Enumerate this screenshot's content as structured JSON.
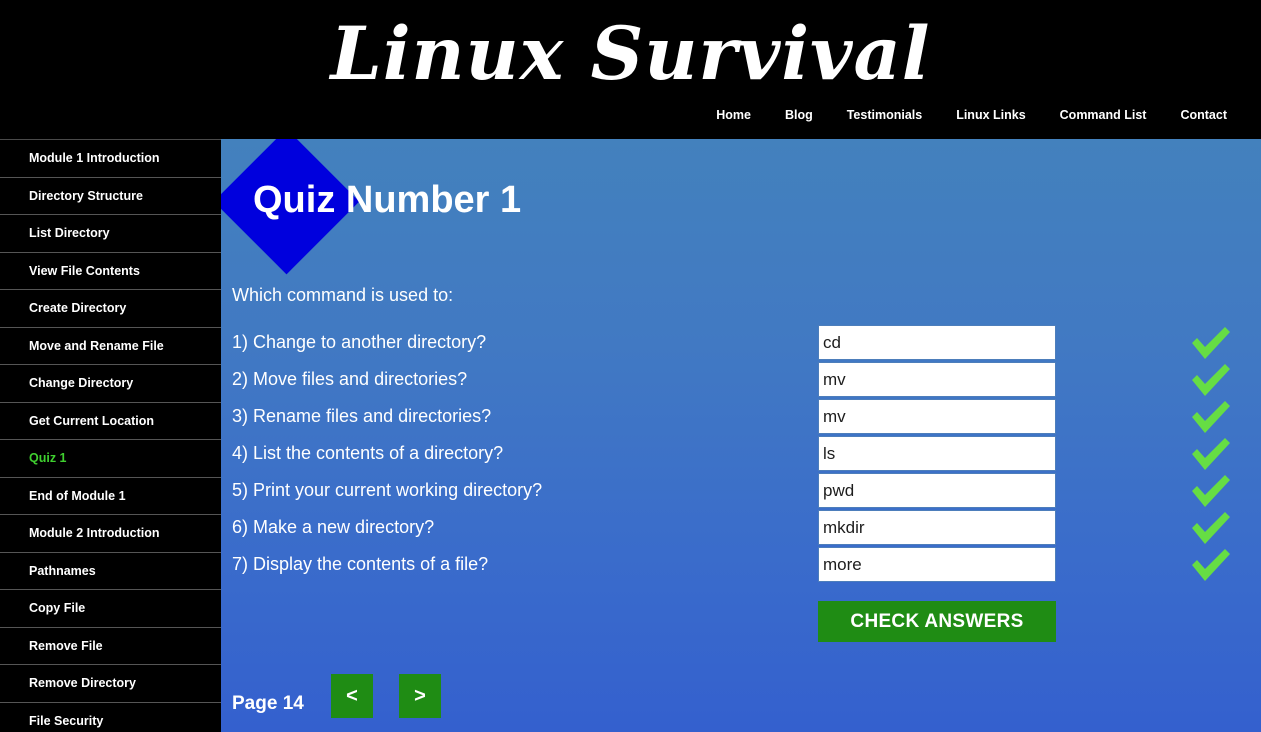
{
  "header": {
    "logo_text": "Linux Survival",
    "nav": [
      {
        "label": "Home"
      },
      {
        "label": "Blog"
      },
      {
        "label": "Testimonials"
      },
      {
        "label": "Linux Links"
      },
      {
        "label": "Command List"
      },
      {
        "label": "Contact"
      }
    ]
  },
  "sidebar": {
    "items": [
      {
        "label": "Module 1 Introduction",
        "active": false
      },
      {
        "label": "Directory Structure",
        "active": false
      },
      {
        "label": "List Directory",
        "active": false
      },
      {
        "label": "View File Contents",
        "active": false
      },
      {
        "label": "Create Directory",
        "active": false
      },
      {
        "label": "Move and Rename File",
        "active": false
      },
      {
        "label": "Change Directory",
        "active": false
      },
      {
        "label": "Get Current Location",
        "active": false
      },
      {
        "label": "Quiz 1",
        "active": true
      },
      {
        "label": "End of Module 1",
        "active": false
      },
      {
        "label": "Module 2 Introduction",
        "active": false
      },
      {
        "label": "Pathnames",
        "active": false
      },
      {
        "label": "Copy File",
        "active": false
      },
      {
        "label": "Remove File",
        "active": false
      },
      {
        "label": "Remove Directory",
        "active": false
      },
      {
        "label": "File Security",
        "active": false
      }
    ],
    "active_color": "#3fcf2f"
  },
  "main": {
    "title": "Quiz Number 1",
    "lead": "Which command is used to:",
    "questions": [
      {
        "text": "1) Change to another directory?",
        "answer": "cd",
        "correct": true
      },
      {
        "text": "2) Move files and directories?",
        "answer": "mv",
        "correct": true
      },
      {
        "text": "3) Rename files and directories?",
        "answer": "mv",
        "correct": true
      },
      {
        "text": "4) List the contents of a directory?",
        "answer": "ls",
        "correct": true
      },
      {
        "text": "5) Print your current working directory?",
        "answer": "pwd",
        "correct": true
      },
      {
        "text": "6) Make a new directory?",
        "answer": "mkdir",
        "correct": true
      },
      {
        "text": "7) Display the contents of a file?",
        "answer": "more",
        "correct": true
      }
    ],
    "check_button_label": "CHECK ANSWERS",
    "page_label": "Page 14",
    "prev_label": "<",
    "next_label": ">",
    "answer_placeholder": ""
  },
  "colors": {
    "header_bg": "#000000",
    "sidebar_bg": "#000000",
    "content_gradient_top": "#4381bd",
    "content_gradient_bottom": "#3460ce",
    "diamond": "#0000dd",
    "button_green": "#1f8c14",
    "check_green": "#66dd44",
    "active_link": "#3fcf2f"
  }
}
